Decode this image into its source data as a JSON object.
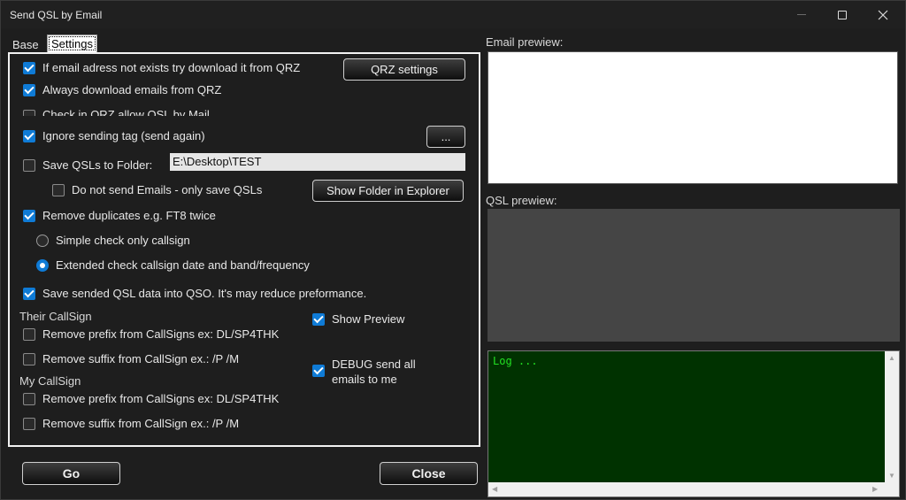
{
  "window": {
    "title": "Send QSL by Email"
  },
  "tabs": {
    "base": "Base",
    "settings": "Settings"
  },
  "settings": {
    "email_not_exists": {
      "label": "If email adress  not exists try download it from QRZ",
      "checked": true
    },
    "always_download": {
      "label": "Always download emails from QRZ",
      "checked": true
    },
    "check_qrz_allow": {
      "label": "Check in QRZ allow QSL by Mail",
      "checked": false
    },
    "ignore_tag": {
      "label": "Ignore sending tag (send again)",
      "checked": true
    },
    "save_to_folder": {
      "label": "Save QSLs to Folder:",
      "checked": false
    },
    "folder_path": "E:\\Desktop\\TEST",
    "do_not_send": {
      "label": "Do not send Emails - only save QSLs",
      "checked": false
    },
    "remove_duplicates": {
      "label": "Remove duplicates e.g. FT8 twice",
      "checked": true
    },
    "simple_check": {
      "label": "Simple check only callsign",
      "selected": false
    },
    "extended_check": {
      "label": "Extended check  callsign date and band/frequency",
      "selected": true
    },
    "save_sended": {
      "label": "Save sended QSL data into QSO. It's may reduce preformance.",
      "checked": true
    },
    "their_callsign_title": "Their CallSign",
    "their_remove_prefix": {
      "label": "Remove prefix from CallSigns ex: DL/SP4THK",
      "checked": false
    },
    "their_remove_suffix": {
      "label": "Remove suffix from CallSign ex.: /P /M",
      "checked": false
    },
    "my_callsign_title": "My CallSign",
    "my_remove_prefix": {
      "label": "Remove prefix from CallSigns ex: DL/SP4THK",
      "checked": false
    },
    "my_remove_suffix": {
      "label": "Remove suffix from CallSign ex.: /P /M",
      "checked": false
    },
    "show_preview": {
      "label": "Show Preview",
      "checked": true
    },
    "debug_send_line1": "DEBUG send all",
    "debug_send_line2": "emails to me",
    "debug_send_checked": true
  },
  "buttons": {
    "qrz_settings": "QRZ settings",
    "browse": "...",
    "show_folder": "Show Folder in Explorer",
    "go": "Go",
    "close": "Close"
  },
  "preview": {
    "email_label": "Email prewiew:",
    "qsl_label": "QSL prewiew:",
    "log_text": "Log ..."
  },
  "colors": {
    "accent": "#0f7bd6",
    "log_bg": "#003200",
    "log_text": "#22e022"
  }
}
